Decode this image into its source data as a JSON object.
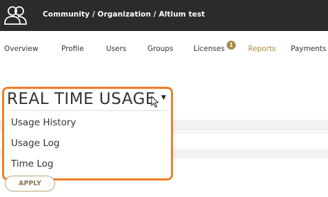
{
  "header": {
    "breadcrumb": "Community / Organization / Altium test",
    "logo_icon": "community-users-icon"
  },
  "nav": {
    "items": [
      {
        "label": "Overview"
      },
      {
        "label": "Profile"
      },
      {
        "label": "Users"
      },
      {
        "label": "Groups"
      },
      {
        "label": "Licenses",
        "badge": "1"
      },
      {
        "label": "Reports",
        "active": true
      },
      {
        "label": "Payments"
      }
    ],
    "active_color": "#b08a3e"
  },
  "dropdown": {
    "selected": "REAL TIME USAGE",
    "options": [
      {
        "label": "Usage History"
      },
      {
        "label": "Usage Log"
      },
      {
        "label": "Time Log"
      }
    ],
    "highlight_color": "#f07e26"
  },
  "apply_button": {
    "label": "APPLY"
  },
  "colors": {
    "header_bg": "#2b2b2b",
    "accent": "#a88845"
  }
}
